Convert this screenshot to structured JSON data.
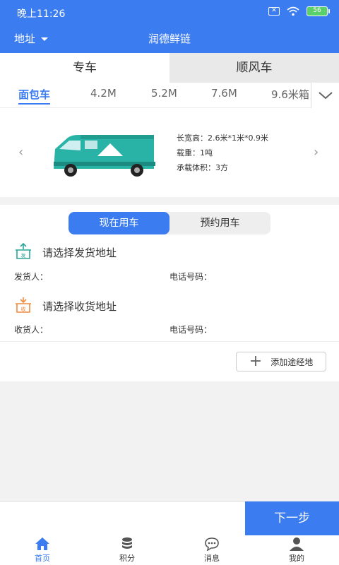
{
  "status": {
    "time": "晚上11:26",
    "battery": "56"
  },
  "header": {
    "address_label": "地址",
    "title": "润德鲜链"
  },
  "main_tabs": [
    {
      "label": "专车"
    },
    {
      "label": "顺风车"
    }
  ],
  "vehicle_types": [
    "面包车",
    "4.2M",
    "5.2M",
    "7.6M",
    "9.6米箱"
  ],
  "car": {
    "dimensions": "长宽高：2.6米*1米*0.9米",
    "load": "载重：1吨",
    "volume": "承载体积：3方"
  },
  "order": {
    "mode_tabs": [
      "现在用车",
      "预约用车"
    ],
    "pickup_prompt": "请选择发货地址",
    "pickup_icon_text": "发",
    "sender_label": "发货人：",
    "sender_phone_label": "电话号码：",
    "delivery_prompt": "请选择收货地址",
    "delivery_icon_text": "收",
    "receiver_label": "收货人：",
    "receiver_phone_label": "电话号码：",
    "add_waypoint": "添加途经地"
  },
  "next_button": "下一步",
  "tabbar": [
    {
      "label": "首页",
      "icon": "home-icon"
    },
    {
      "label": "积分",
      "icon": "coins-icon"
    },
    {
      "label": "消息",
      "icon": "message-icon"
    },
    {
      "label": "我的",
      "icon": "user-icon"
    }
  ],
  "colors": {
    "primary": "#3b7cf0",
    "pickup": "#2aa69a",
    "delivery": "#f08a3c"
  }
}
